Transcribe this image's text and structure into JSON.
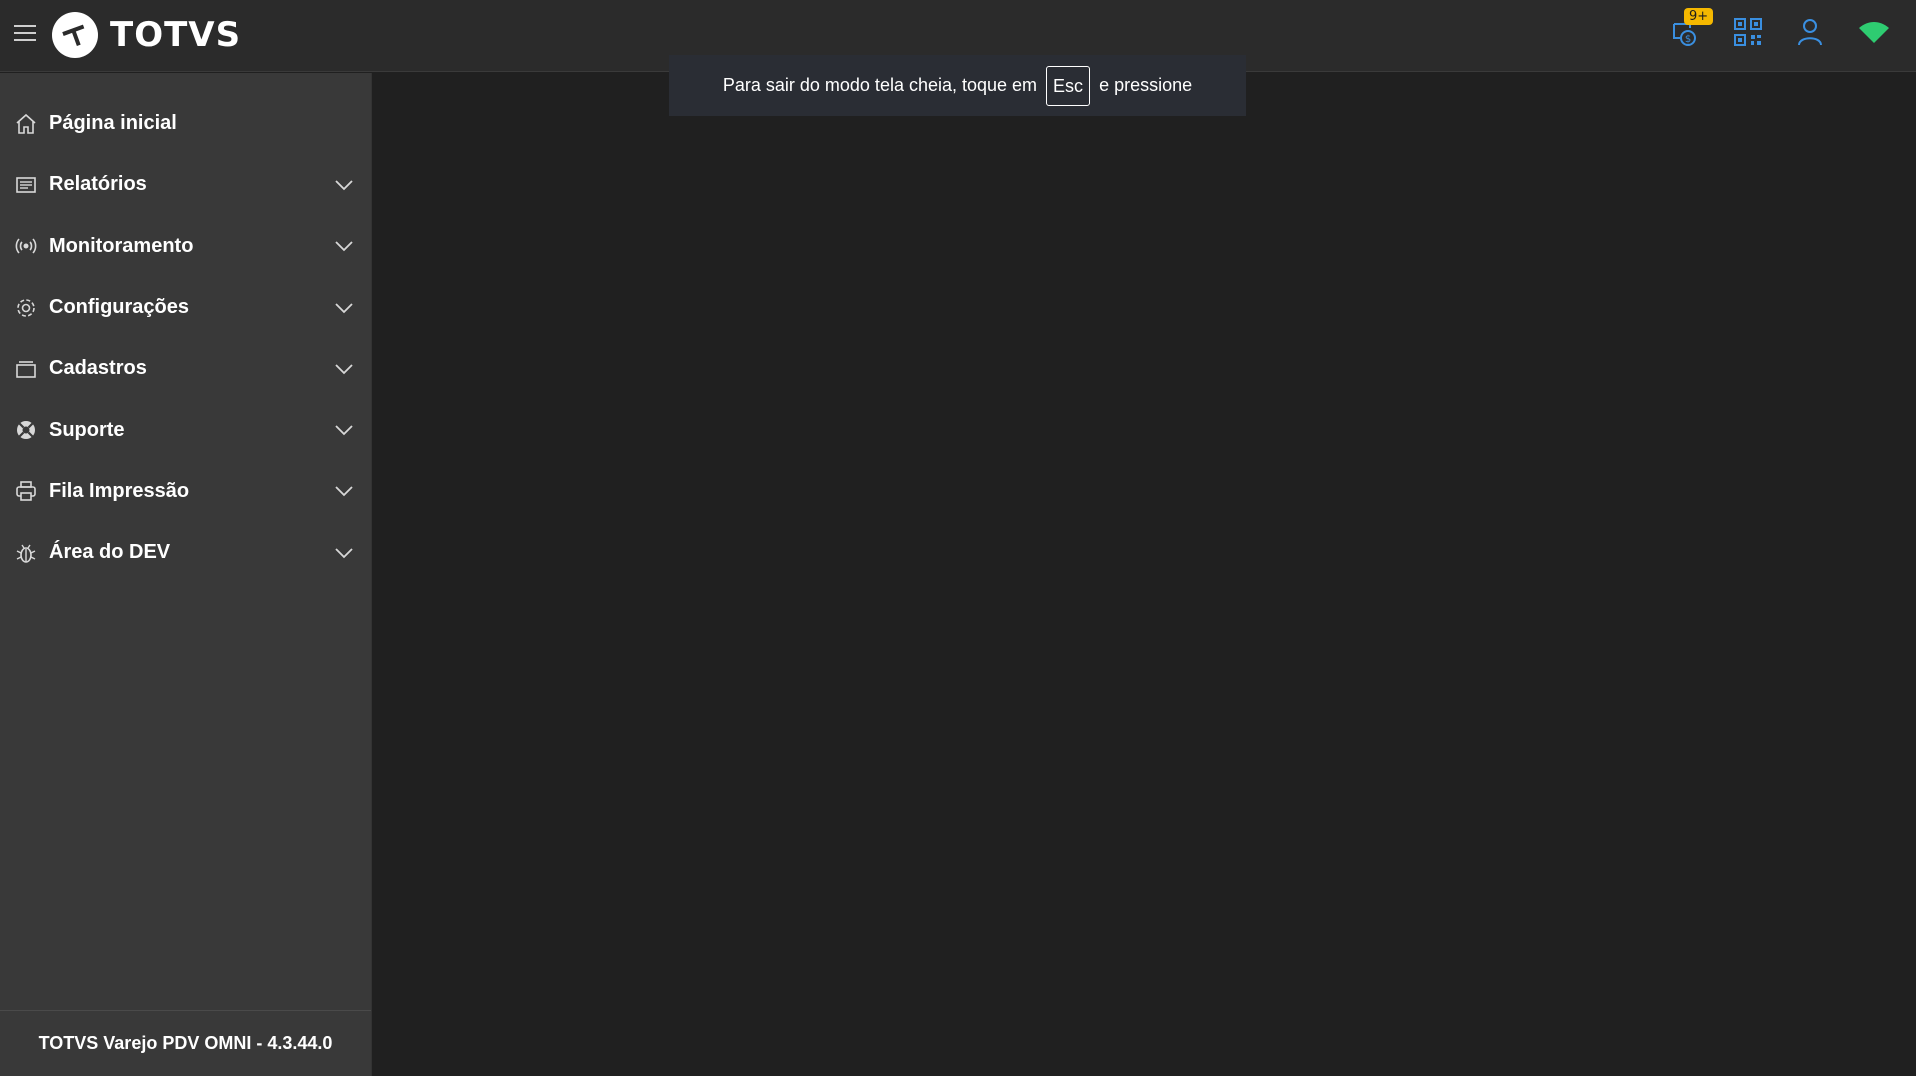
{
  "header": {
    "brand": "TOTVS",
    "notification_badge": "9+",
    "connection_status_color": "#2ecc71",
    "accent_color": "#3a8fe0",
    "icons": [
      "menu-icon",
      "totvs-logo-icon",
      "payment-sync-icon",
      "qr-code-icon",
      "user-icon",
      "wifi-icon"
    ]
  },
  "sidebar": {
    "items": [
      {
        "label": "Página inicial",
        "icon": "home-icon",
        "expandable": false
      },
      {
        "label": "Relatórios",
        "icon": "report-icon",
        "expandable": true
      },
      {
        "label": "Monitoramento",
        "icon": "broadcast-icon",
        "expandable": true
      },
      {
        "label": "Configurações",
        "icon": "gear-icon",
        "expandable": true
      },
      {
        "label": "Cadastros",
        "icon": "folder-icon",
        "expandable": true
      },
      {
        "label": "Suporte",
        "icon": "lifebuoy-icon",
        "expandable": true
      },
      {
        "label": "Fila Impressão",
        "icon": "printer-icon",
        "expandable": true
      },
      {
        "label": "Área do DEV",
        "icon": "bug-icon",
        "expandable": true
      }
    ],
    "footer": "TOTVS Varejo PDV OMNI - 4.3.44.0"
  },
  "fullscreen_toast": {
    "text_before": "Para sair do modo tela cheia, toque em",
    "key": "Esc",
    "text_after": "e pressione"
  }
}
